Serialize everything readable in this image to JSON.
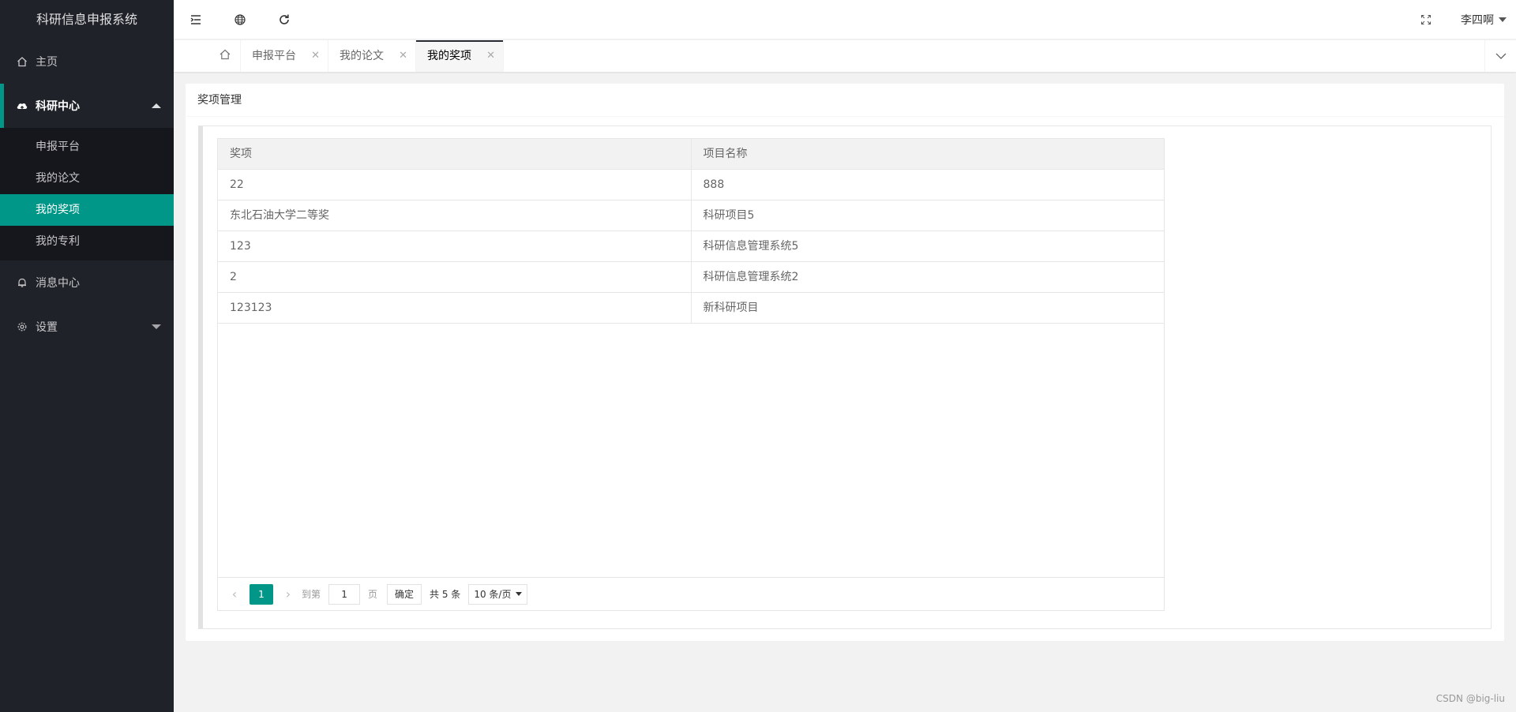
{
  "app": {
    "title": "科研信息申报系统"
  },
  "sidebar": {
    "items": [
      {
        "label": "主页",
        "icon": "home-icon"
      },
      {
        "label": "科研中心",
        "icon": "cloud-upload-icon",
        "expanded": true,
        "children": [
          {
            "label": "申报平台"
          },
          {
            "label": "我的论文"
          },
          {
            "label": "我的奖项",
            "active": true
          },
          {
            "label": "我的专利"
          }
        ]
      },
      {
        "label": "消息中心",
        "icon": "bell-icon"
      },
      {
        "label": "设置",
        "icon": "gear-icon"
      }
    ]
  },
  "header": {
    "user_name": "李四啊"
  },
  "tabs": [
    {
      "label": "申报平台"
    },
    {
      "label": "我的论文"
    },
    {
      "label": "我的奖项",
      "active": true
    }
  ],
  "main": {
    "card_title": "奖项管理",
    "table": {
      "columns": [
        "奖项",
        "项目名称"
      ],
      "rows": [
        [
          "22",
          "888"
        ],
        [
          "东北石油大学二等奖",
          "科研项目5"
        ],
        [
          "123",
          "科研信息管理系统5"
        ],
        [
          "2",
          "科研信息管理系统2"
        ],
        [
          "123123",
          "新科研项目"
        ]
      ]
    },
    "pagination": {
      "current_page": "1",
      "goto_label": "到第",
      "goto_value": "1",
      "page_label": "页",
      "confirm_label": "确定",
      "total_label": "共 5 条",
      "page_size": "10 条/页"
    }
  },
  "watermark": "CSDN @big-liu",
  "colors": {
    "accent": "#009688",
    "sidebar_bg": "#20222a",
    "subnav_bg": "#16171d"
  }
}
